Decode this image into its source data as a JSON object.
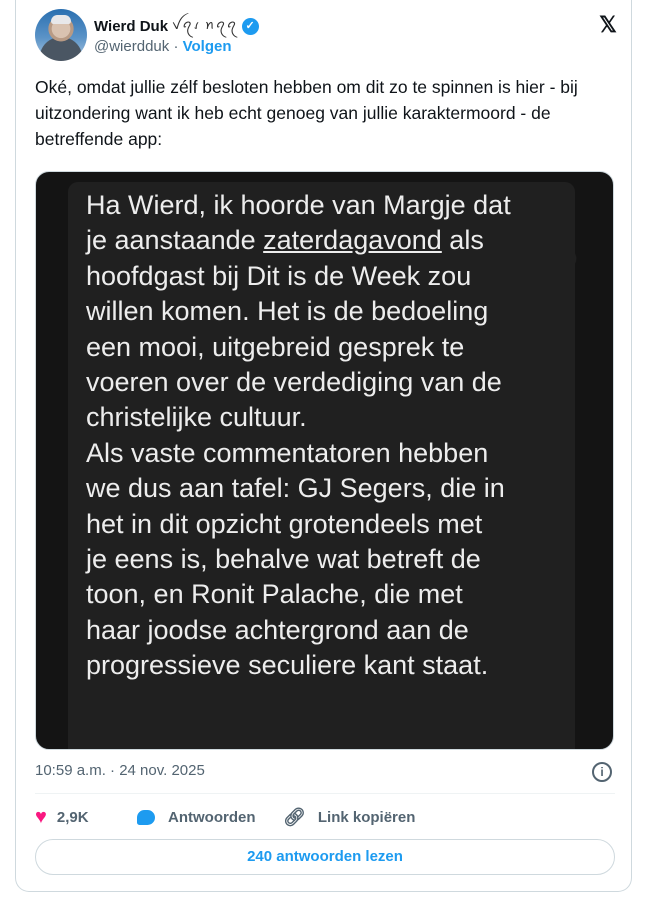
{
  "author": {
    "name": "Wierd Duk",
    "name_deco": "ꪜꪖꪹ ꪀꪖꪖ",
    "handle": "@wierdduk",
    "separator": "·",
    "follow_label": "Volgen",
    "verified_icon": "verified-badge-icon"
  },
  "tweet": {
    "text": "Oké, omdat jullie zélf besloten hebben om dit zo te spinnen is hier - bij uitzondering want ik heb echt genoeg van jullie karaktermoord - de betreffende app:"
  },
  "message": {
    "part1": "Ha Wierd, ik hoorde van Margje dat\nje aanstaande ",
    "underlined": "zaterdagavond",
    "part2": " als\nhoofdgast bij Dit is de Week zou\nwillen komen. Het is de bedoeling\neen mooi, uitgebreid  gesprek  te\nvoeren over de verdediging van de\nchristelijke cultuur.\nAls vaste commentatoren hebben\nwe dus aan tafel: GJ Segers, die in\nhet in dit opzicht grotendeels met\nje eens is, behalve wat betreft de\ntoon, en Ronit Palache, die met\nhaar joodse achtergrond aan de\nprogressieve seculiere kant staat."
  },
  "meta": {
    "timestamp": "10:59 a.m. · 24 nov. 2025"
  },
  "actions": {
    "likes": "2,9K",
    "reply_label": "Antwoorden",
    "copy_link_label": "Link kopiëren"
  },
  "read_replies_label": "240 antwoorden lezen",
  "colors": {
    "accent": "#1d9bf0",
    "like": "#f91880",
    "muted": "#536471"
  }
}
